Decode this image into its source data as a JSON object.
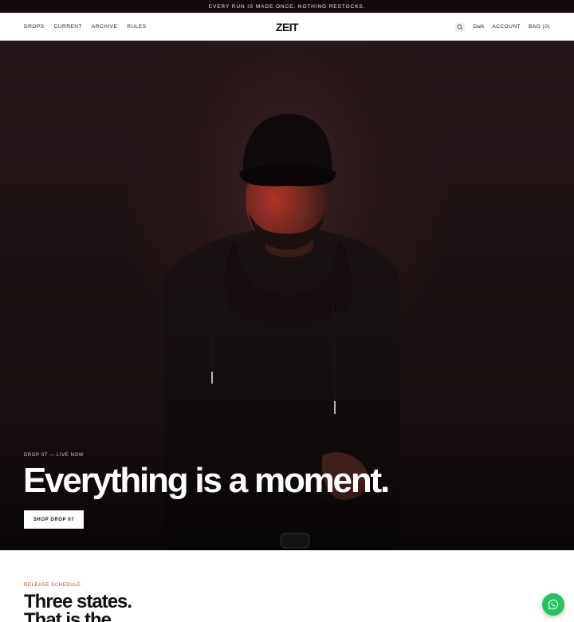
{
  "announcement": {
    "text": "EVERY RUN IS MADE ONCE. NOTHING RESTOCKS."
  },
  "header": {
    "logo": "ZEIT",
    "nav_left": [
      "DROPS",
      "CURRENT",
      "ARCHIVE",
      "RULES"
    ],
    "search_icon": "search-icon",
    "theme_toggle": "Dark",
    "account": "ACCOUNT",
    "bag": "BAG (0)"
  },
  "hero": {
    "eyebrow": "DROP 07 — LIVE NOW",
    "title": "Everything is a moment.",
    "cta": "SHOP DROP 07"
  },
  "release": {
    "eyebrow": "RELEASE SCHEDULE",
    "title_line1": "Three states.",
    "title_line2": "That is the"
  },
  "chat": {
    "icon": "whatsapp-icon"
  },
  "colors": {
    "announcement_bg": "#140a0d",
    "accent_red": "#d3382c",
    "chat_green": "#25c35f",
    "hero_bg": "#1b1112"
  }
}
